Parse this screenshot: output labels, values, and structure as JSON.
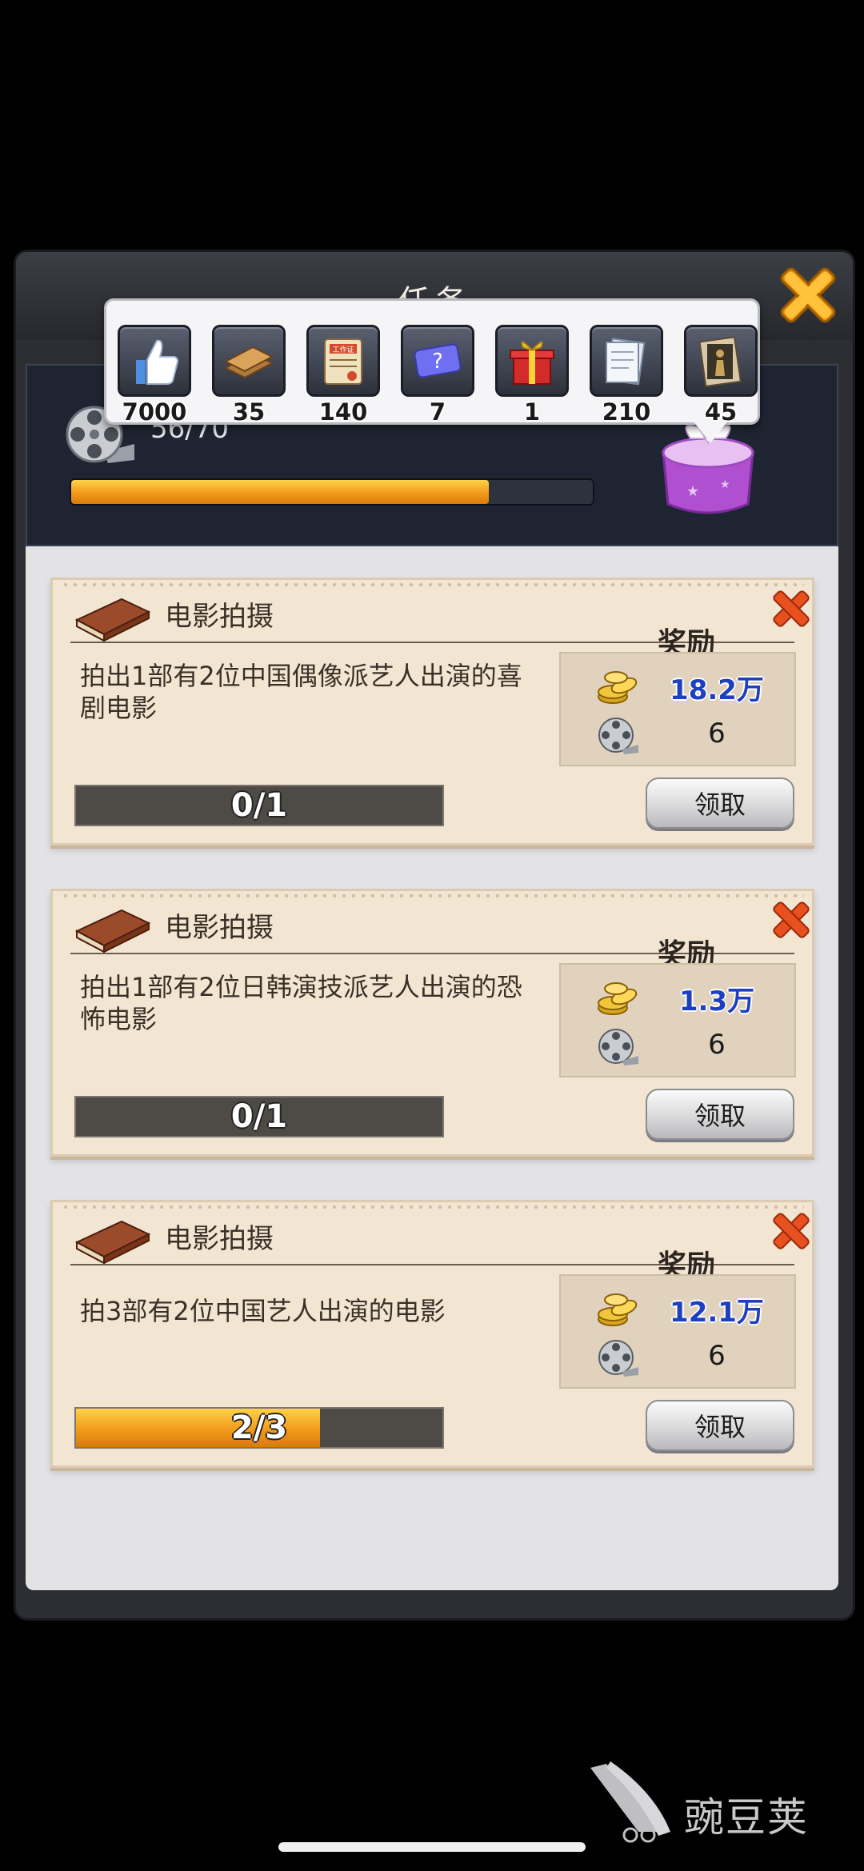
{
  "dialog": {
    "title": "任务",
    "progress_counter": "56/70",
    "progress_fraction": 0.8
  },
  "reward_popup": {
    "items": [
      {
        "icon": "thumbs-up-icon",
        "count": "7000"
      },
      {
        "icon": "wood-planks-icon",
        "count": "35"
      },
      {
        "icon": "work-document-icon",
        "count": "140",
        "icon_text": "工作证"
      },
      {
        "icon": "mystery-ticket-icon",
        "count": "7"
      },
      {
        "icon": "gift-box-icon",
        "count": "1"
      },
      {
        "icon": "script-scroll-icon",
        "count": "210"
      },
      {
        "icon": "poster-icon",
        "count": "45"
      }
    ]
  },
  "tasks": [
    {
      "category": "电影拍摄",
      "description": "拍出1部有2位中国偶像派艺人出演的喜剧电影",
      "reward_label": "奖励",
      "reward_money": "18.2万",
      "reward_film": "6",
      "progress_text": "0/1",
      "progress_fraction": 0,
      "claim_label": "领取"
    },
    {
      "category": "电影拍摄",
      "description": "拍出1部有2位日韩演技派艺人出演的恐怖电影",
      "reward_label": "奖励",
      "reward_money": "1.3万",
      "reward_film": "6",
      "progress_text": "0/1",
      "progress_fraction": 0,
      "claim_label": "领取"
    },
    {
      "category": "电影拍摄",
      "description": "拍3部有2位中国艺人出演的电影",
      "reward_label": "奖励",
      "reward_money": "12.1万",
      "reward_film": "6",
      "progress_text": "2/3",
      "progress_fraction": 0.667,
      "claim_label": "领取"
    }
  ],
  "watermark": {
    "text": "豌豆荚"
  },
  "colors": {
    "accent_orange": "#f29b1a",
    "close_orange": "#e8501f",
    "money_blue": "#1e3fbf"
  }
}
